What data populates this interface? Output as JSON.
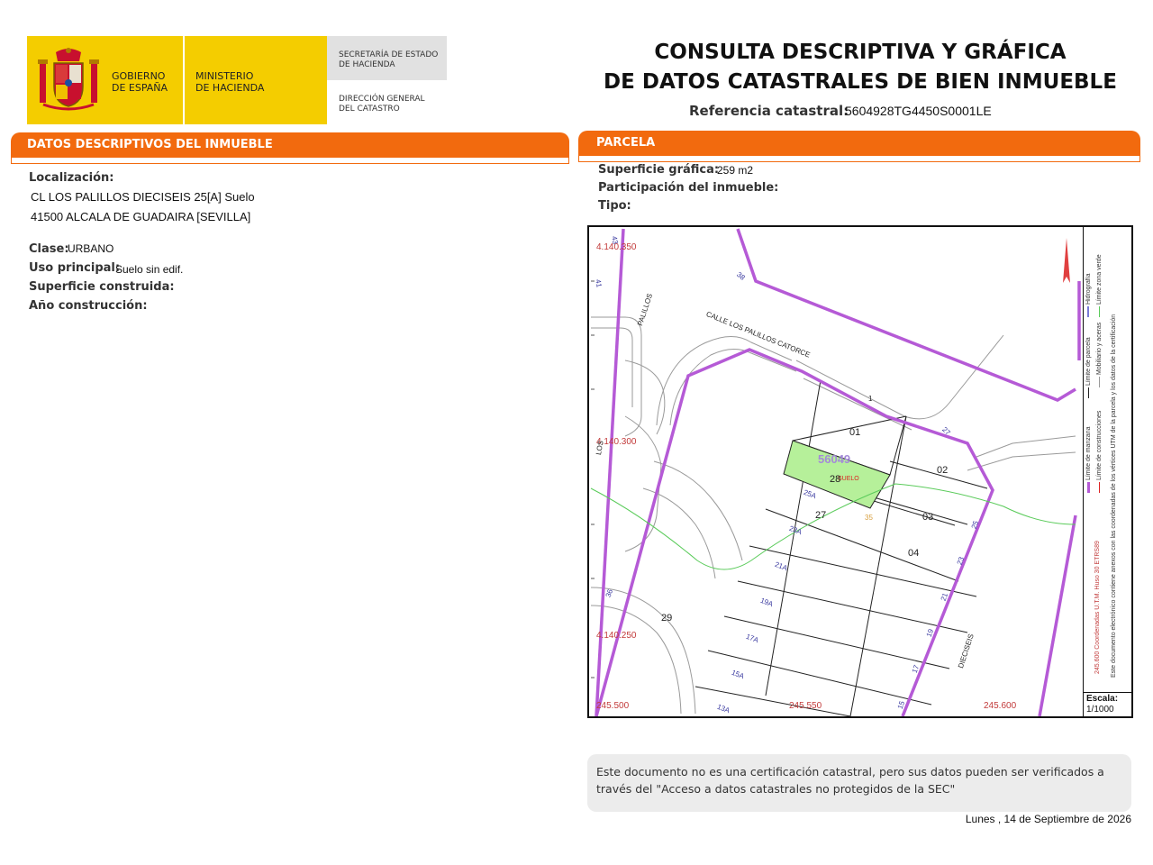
{
  "header": {
    "gov_line1": "GOBIERNO",
    "gov_line2": "DE ESPAÑA",
    "min_line1": "MINISTERIO",
    "min_line2": "DE HACIENDA",
    "sec_line1": "SECRETARÍA DE ESTADO",
    "sec_line2": "DE HACIENDA",
    "dir_line1": "DIRECCIÓN GENERAL",
    "dir_line2": "DEL CATASTRO",
    "title_line1": "CONSULTA DESCRIPTIVA Y GRÁFICA",
    "title_line2": "DE DATOS CATASTRALES DE BIEN INMUEBLE",
    "ref_label": "Referencia catastral:",
    "ref_value": "5604928TG4450S0001LE",
    "colors": {
      "yellow": "#f4cd00",
      "orange": "#f26a0e",
      "gray": "#e1e1e1"
    }
  },
  "datos": {
    "section_title": "DATOS DESCRIPTIVOS DEL INMUEBLE",
    "localizacion_label": "Localización:",
    "localizacion_line1": "CL LOS PALILLOS DIECISEIS 25[A] Suelo",
    "localizacion_line2": "41500 ALCALA DE GUADAIRA [SEVILLA]",
    "clase_label": "Clase:",
    "clase_value": "URBANO",
    "uso_label": "Uso principal:",
    "uso_value": "Suelo sin edif.",
    "sup_construida_label": "Superficie construida:",
    "anio_label": "Año construcción:"
  },
  "parcela": {
    "section_title": "PARCELA",
    "sup_grafica_label": "Superficie gráfica:",
    "sup_grafica_value": "259 m2",
    "participacion_label": "Participación del inmueble:",
    "tipo_label": "Tipo:"
  },
  "map": {
    "coord_4140350": "4.140.350",
    "coord_4140300": "4.140.300",
    "coord_4140250": "4.140.250",
    "coord_245500": "245.500",
    "coord_245550": "245.550",
    "coord_245600": "245.600",
    "street_catorce": "CALLE LOS PALILLOS CATORCE",
    "street_palillos": "PALILLOS",
    "street_dieciseis": "DIECISEIS",
    "street_los": "LOS",
    "parcel_ref": "56049",
    "suelo_label": "SUELO",
    "lots": [
      "01",
      "02",
      "03",
      "04",
      "28",
      "27",
      "29"
    ],
    "numbers": [
      "1",
      "27",
      "25",
      "23",
      "21",
      "19",
      "17",
      "15",
      "38",
      "36",
      "41",
      "43",
      "35"
    ],
    "lot_codes": [
      "25A",
      "23A",
      "21A",
      "19A",
      "17A",
      "15A",
      "13A"
    ],
    "legend": {
      "l1": "Límite de manzana",
      "l2": "Límite de parcela",
      "l3": "Hidrografía",
      "l4": "Límite de construcciones",
      "l5": "Mobiliario y aceras",
      "l6": "Límite zona verde",
      "coords_note": "245.600 Coordenadas U.T.M. Huso 30 ETRS89",
      "vertices_note": "Este documento electrónico contiene anexos con las coordenadas de los vértices UTM de la parcela y los datos de la certificación"
    },
    "escala_label": "Escala:",
    "escala_value": "1/1000"
  },
  "footer": {
    "note": "Este documento no es una certificación catastral, pero sus datos pueden ser verificados a través del \"Acceso a datos catastrales no protegidos de la SEC\"",
    "date": "Lunes , 14 de Septiembre de 2026"
  }
}
